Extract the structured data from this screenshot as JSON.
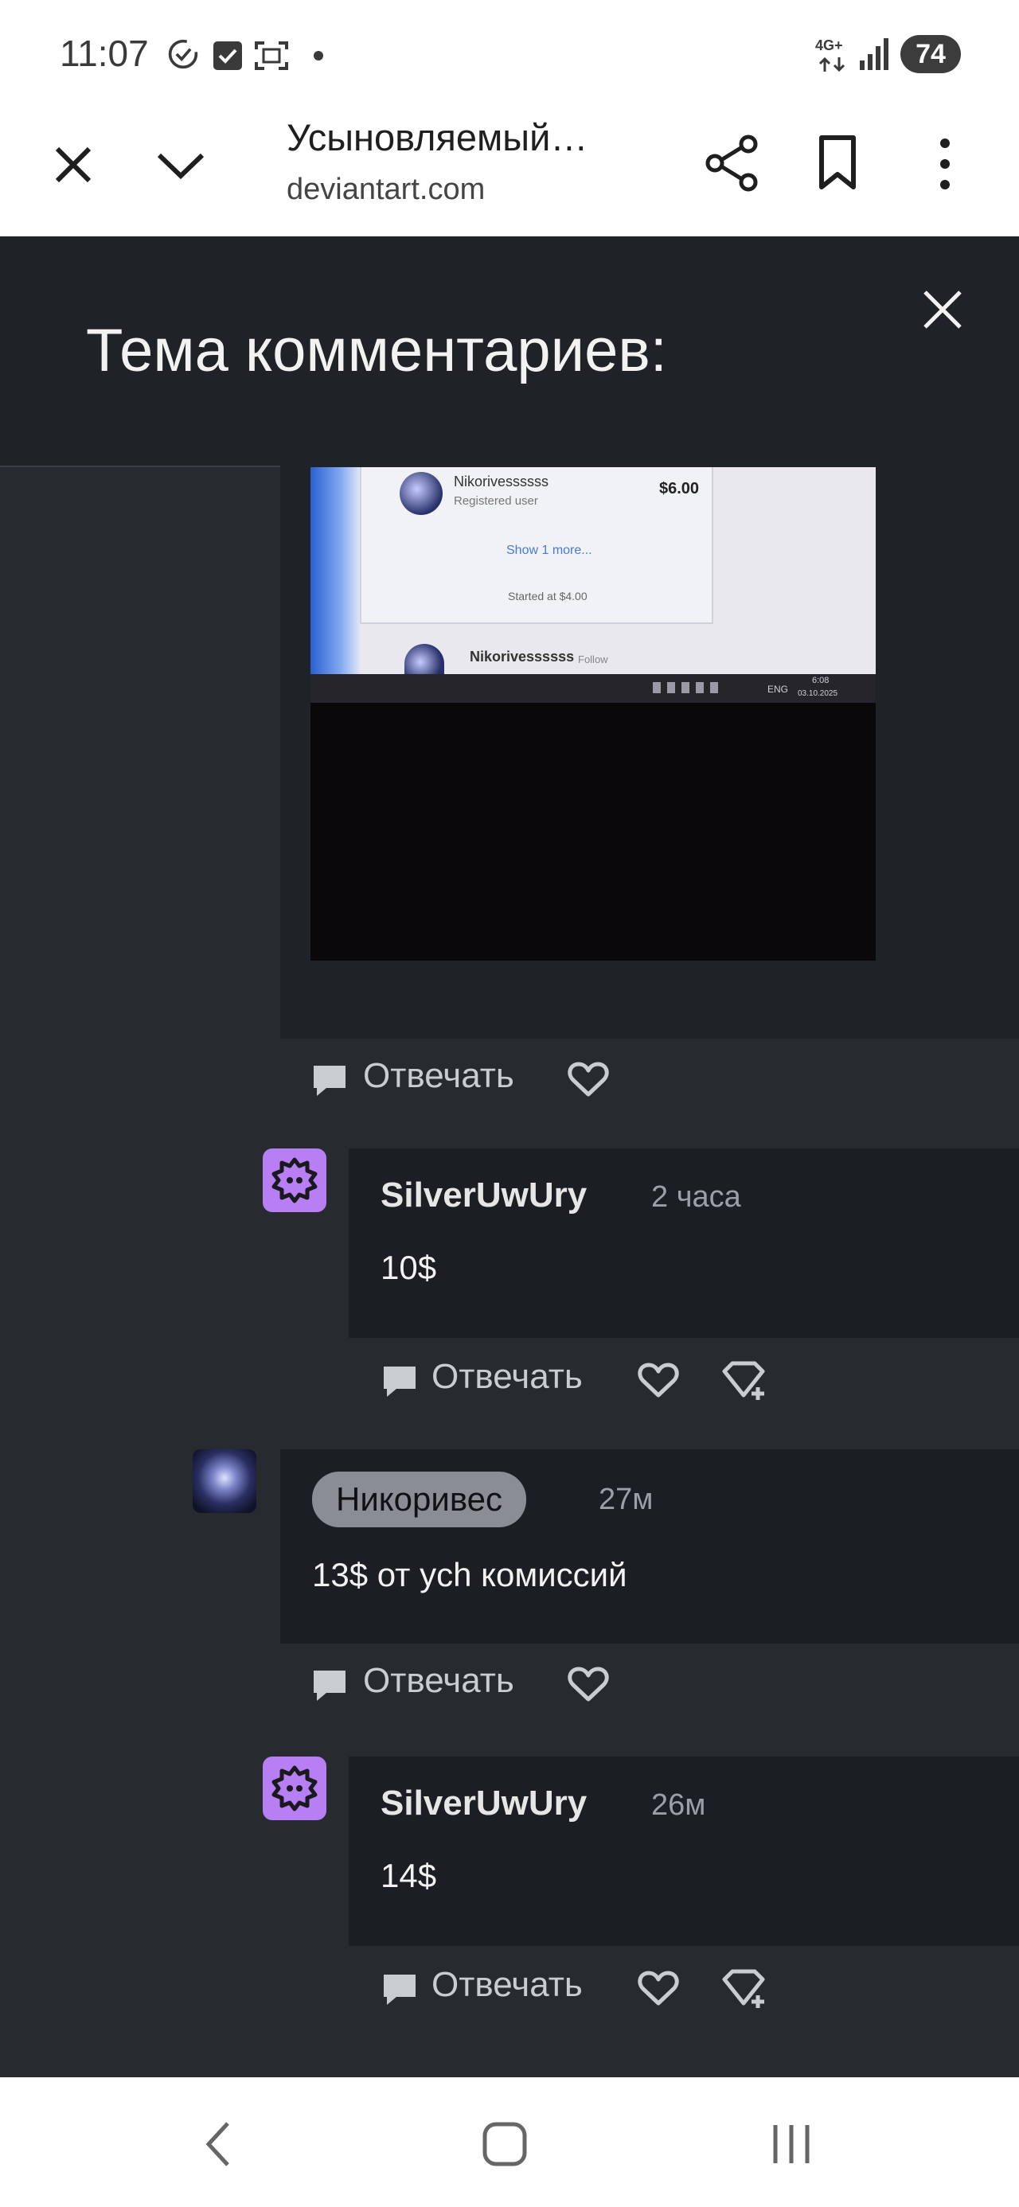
{
  "status_bar": {
    "time": "11:07",
    "network": "4G+",
    "battery": "74"
  },
  "browser": {
    "title": "Усыновляемый…",
    "url": "deviantart.com"
  },
  "panel": {
    "title": "Тема комментариев:"
  },
  "photo": {
    "user1_name": "Nikorivessssss",
    "user1_role": "Registered user",
    "price": "$6.00",
    "show_more": "Show 1 more...",
    "started_at": "Started at $4.00",
    "user2_name": "Nikorivessssss",
    "follow": "Follow",
    "taskbar_lang": "ENG",
    "taskbar_time": "6:08",
    "taskbar_date": "03.10.2025"
  },
  "comments": [
    {
      "reply_label": "Отвечать"
    },
    {
      "username": "SilverUwUry",
      "time": "2 часа",
      "text": "10$",
      "reply_label": "Отвечать"
    },
    {
      "username": "Никоривес",
      "time": "27м",
      "text": "13$ от ych комиссий",
      "reply_label": "Отвечать"
    },
    {
      "username": "SilverUwUry",
      "time": "26м",
      "text": "14$",
      "reply_label": "Отвечать"
    }
  ],
  "colors": {
    "panel_bg": "#272b30",
    "comment_bg": "#1b1e22",
    "avatar_purple": "#b87ff5"
  }
}
